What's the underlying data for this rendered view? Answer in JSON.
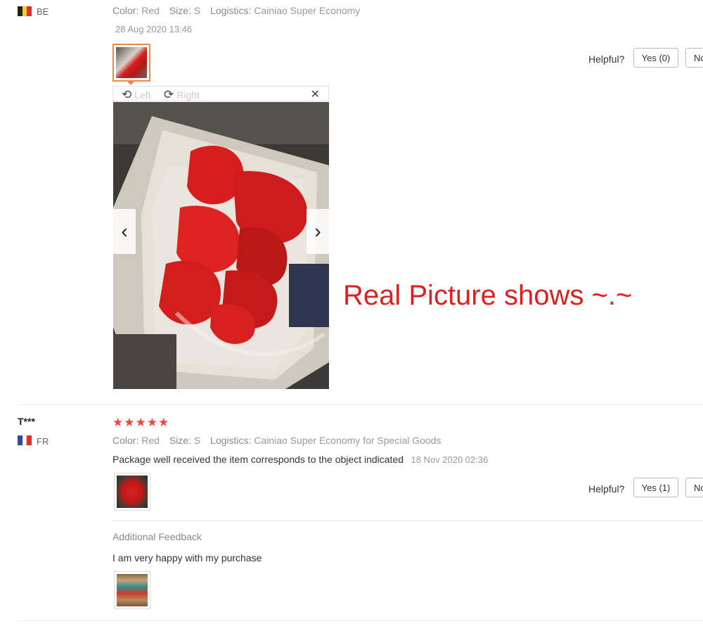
{
  "review1": {
    "country": "BE",
    "flag_colors": [
      "#222222",
      "#f5d028",
      "#e0302a"
    ],
    "attributes": [
      {
        "key": "Color:",
        "value": "Red"
      },
      {
        "key": "Size:",
        "value": "S"
      },
      {
        "key": "Logistics:",
        "value": "Cainiao Super Economy"
      }
    ],
    "date": "28 Aug 2020 13:46",
    "viewer": {
      "rotate_left_label": "Left",
      "rotate_right_label": "Right",
      "rotate_left_icon": "rotate-left-icon",
      "rotate_right_icon": "rotate-right-icon",
      "close_icon": "close-icon",
      "prev_icon": "chevron-left-icon",
      "next_icon": "chevron-right-icon"
    },
    "helpful_label": "Helpful?",
    "yes_label": "Yes (0)",
    "no_label": "No"
  },
  "caption": "Real Picture shows ~.~",
  "review2": {
    "user": "T***",
    "country": "FR",
    "flag_colors": [
      "#2b4ea8",
      "#ffffff",
      "#e0302a"
    ],
    "stars": "★★★★★",
    "star_color": "#f0453a",
    "attributes": [
      {
        "key": "Color:",
        "value": "Red"
      },
      {
        "key": "Size:",
        "value": "S"
      },
      {
        "key": "Logistics:",
        "value": "Cainiao Super Economy for Special Goods"
      }
    ],
    "text": "Package well received the item corresponds to the object indicated",
    "date": "18 Nov 2020 02:36",
    "helpful_label": "Helpful?",
    "yes_label": "Yes (1)",
    "no_label": "No",
    "additional_feedback_label": "Additional Feedback",
    "additional_text": "I am very happy with my purchase"
  },
  "colors": {
    "accent": "#f08a4b",
    "caption": "#e02020"
  }
}
